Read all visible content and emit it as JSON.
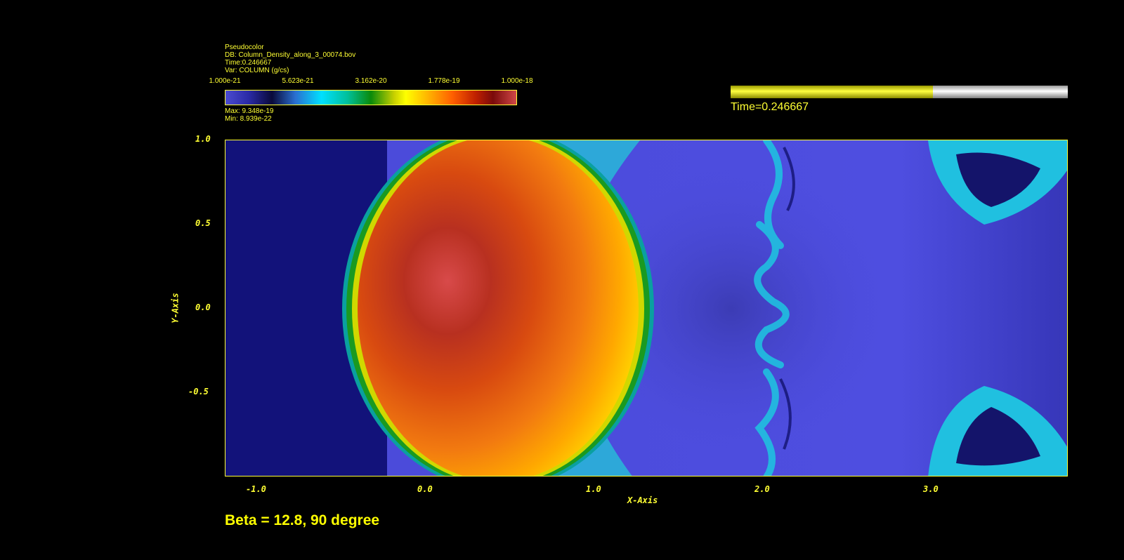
{
  "legend": {
    "plot_type": "Pseudocolor",
    "db": "DB: Column_Density_along_3_00074.bov",
    "time": "Time:0.246667",
    "var": "Var: COLUMN (g/cs)",
    "max": "Max:  9.348e-19",
    "min": "Min:  8.939e-22",
    "colorbar_labels": [
      "1.000e-21",
      "5.623e-21",
      "3.162e-20",
      "1.778e-19",
      "1.000e-18"
    ]
  },
  "time_slider": {
    "label": "Time=0.246667",
    "progress": 0.6,
    "fill_color": "#ffff00",
    "track_color": "#c0c0c0"
  },
  "plot": {
    "x_axis_title": "X-Axis",
    "y_axis_title": "Y-Axis",
    "x_ticks": [
      "-1.0",
      "0.0",
      "1.0",
      "2.0",
      "3.0"
    ],
    "y_ticks": [
      "1.0",
      "0.5",
      "0.0",
      "-0.5"
    ],
    "x_range": [
      -1.2,
      3.8
    ],
    "y_range": [
      -1.0,
      1.0
    ],
    "axis_color": "#ffff33"
  },
  "caption": "Beta = 12.8, 90 degree"
}
